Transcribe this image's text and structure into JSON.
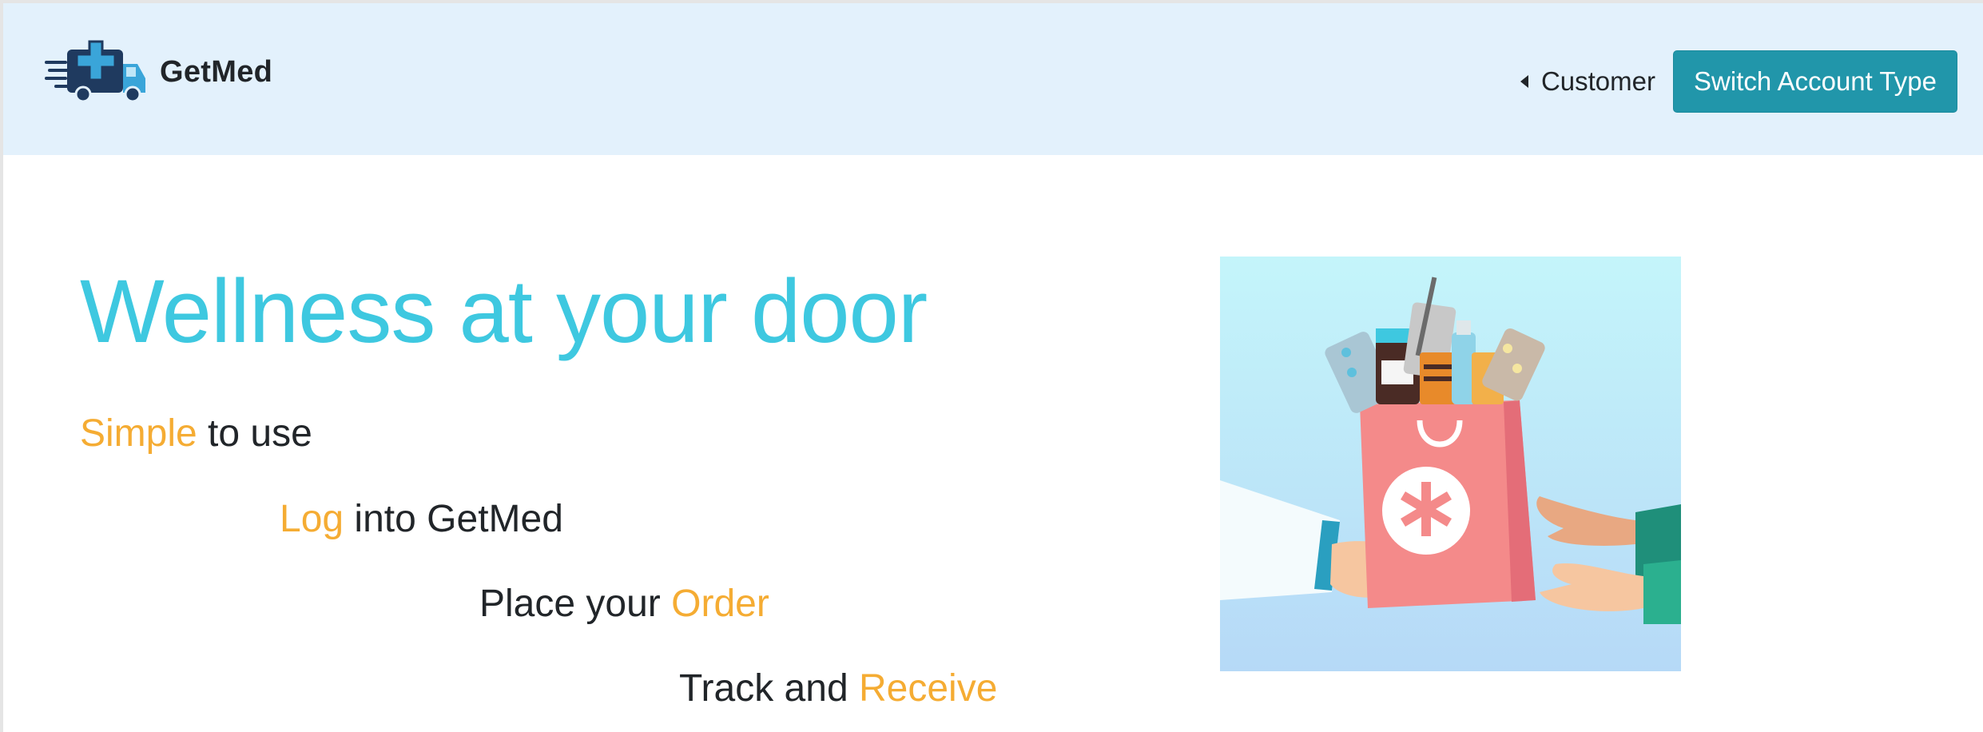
{
  "navbar": {
    "brand_name": "GetMed",
    "logo_icon": "delivery-truck-medical-cross-icon",
    "dropdown_label": "Customer",
    "switch_button_label": "Switch Account Type"
  },
  "hero": {
    "title": "Wellness at your door",
    "steps": [
      {
        "before": "",
        "accent": "Simple",
        "after": " to use"
      },
      {
        "before": "",
        "accent": "Log",
        "after": " into GetMed"
      },
      {
        "before": "Place your ",
        "accent": "Order",
        "after": ""
      },
      {
        "before": "Track and ",
        "accent": "Receive",
        "after": ""
      }
    ],
    "image_icon": "pharmacy-bag-handover-illustration"
  },
  "colors": {
    "navbar_bg": "#e3f1fc",
    "title_color": "#3ec8e0",
    "accent": "#f5ac33",
    "button_bg": "#2196aa"
  }
}
